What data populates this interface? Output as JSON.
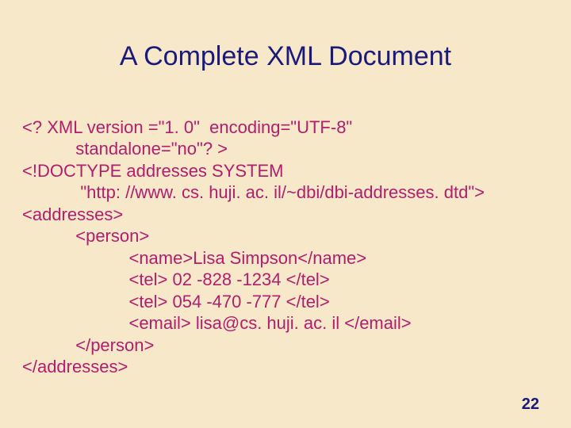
{
  "title": "A Complete XML Document",
  "code": {
    "l0": "<? XML version =\"1. 0\"  encoding=\"UTF-8\"",
    "l1": "           standalone=\"no\"? >",
    "l2": "<!DOCTYPE addresses SYSTEM",
    "l3": "            \"http: //www. cs. huji. ac. il/~dbi/dbi-addresses. dtd\">",
    "l4": "<addresses>",
    "l5": "           <person>",
    "l6": "                      <name>Lisa Simpson</name>",
    "l7": "                      <tel> 02 -828 -1234 </tel>",
    "l8": "                      <tel> 054 -470 -777 </tel>",
    "l9": "                      <email> lisa@cs. huji. ac. il </email>",
    "l10": "           </person>",
    "l11": "</addresses>"
  },
  "page_number": "22"
}
